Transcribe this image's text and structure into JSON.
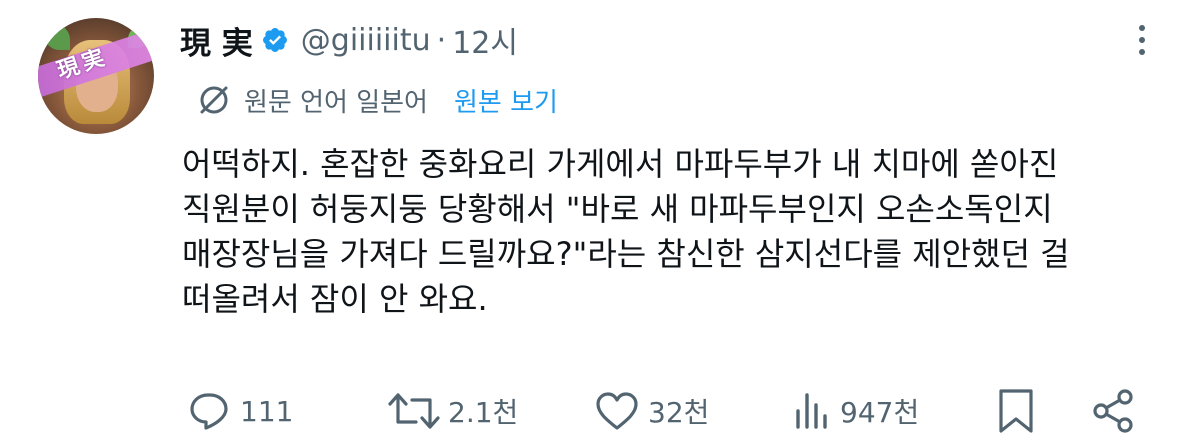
{
  "author": {
    "name": "現 実",
    "handle": "@giiiiiitu",
    "separator": "·",
    "time": "12시",
    "verified": true,
    "avatar_stamp": "現実"
  },
  "translation": {
    "label": "원문 언어 일본어",
    "view_original": "원본 보기"
  },
  "tweet_lines": [
    "어떡하지. 혼잡한 중화요리 가게에서 마파두부가 내 치마에 쏟아진",
    "직원분이 허둥지둥 당황해서 \"바로 새 마파두부인지 오손소독인지",
    "매장장님을 가져다 드릴까요?\"라는 참신한 삼지선다를 제안했던 걸",
    "떠올려서 잠이 안 와요."
  ],
  "actions": {
    "reply_count": "111",
    "retweet_count": "2.1천",
    "like_count": "32천",
    "views_count": "947천"
  },
  "colors": {
    "text": "#0f1419",
    "muted": "#536471",
    "accent": "#1d9bf0"
  },
  "icons": [
    "verified-badge-icon",
    "more-icon",
    "translate-icon",
    "reply-icon",
    "retweet-icon",
    "like-icon",
    "views-icon",
    "bookmark-icon",
    "share-icon"
  ]
}
